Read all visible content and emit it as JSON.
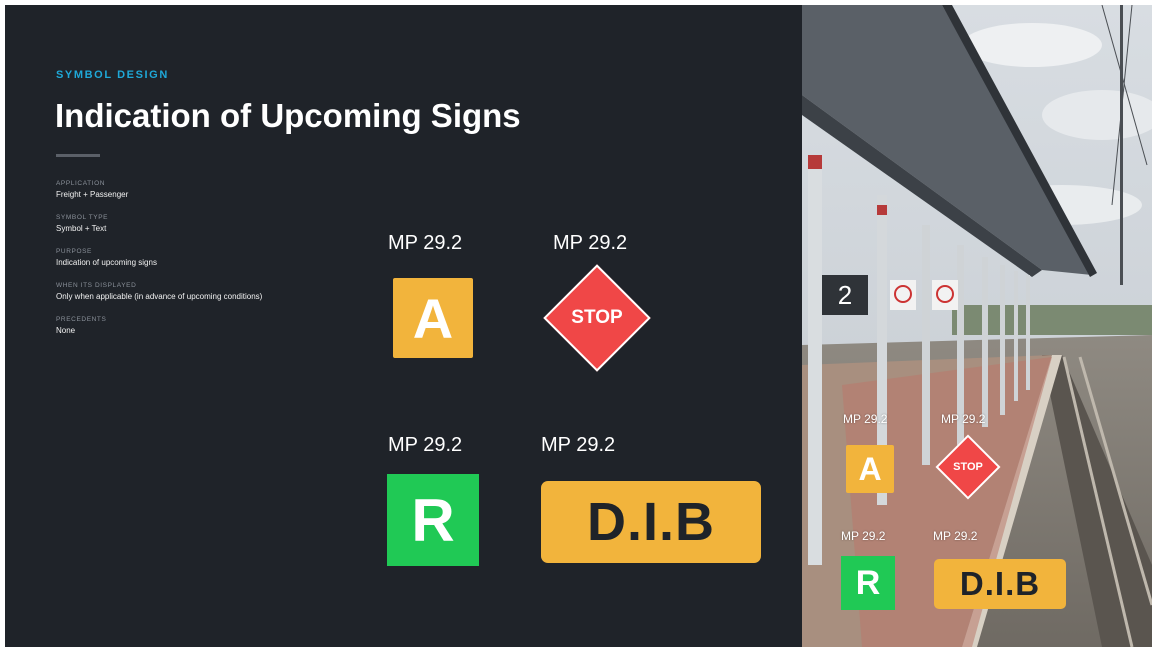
{
  "slide": {
    "eyebrow": "SYMBOL DESIGN",
    "title": "Indication of Upcoming Signs",
    "meta": [
      {
        "label": "APPLICATION",
        "value": "Freight + Passenger"
      },
      {
        "label": "SYMBOL TYPE",
        "value": "Symbol + Text"
      },
      {
        "label": "PURPOSE",
        "value": "Indication of upcoming signs"
      },
      {
        "label": "WHEN ITS DISPLAYED",
        "value": "Only when applicable (in advance of upcoming conditions)"
      },
      {
        "label": "PRECEDENTS",
        "value": "None"
      }
    ],
    "signs": {
      "a": {
        "mp": "MP 29.2",
        "label": "A"
      },
      "stop": {
        "mp": "MP 29.2",
        "label": "STOP"
      },
      "r": {
        "mp": "MP 29.2",
        "label": "R"
      },
      "dib": {
        "mp": "MP 29.2",
        "label": "D.I.B"
      }
    }
  },
  "photo": {
    "platform_number": "2",
    "overlay": {
      "a": {
        "mp": "MP 29.2",
        "label": "A"
      },
      "stop": {
        "mp": "MP 29.2",
        "label": "STOP"
      },
      "r": {
        "mp": "MP 29.2",
        "label": "R"
      },
      "dib": {
        "mp": "MP 29.2",
        "label": "D.I.B"
      }
    }
  },
  "colors": {
    "background": "#1f2329",
    "accent": "#1fa8d8",
    "sign_yellow": "#f2b43c",
    "sign_red": "#f04747",
    "sign_green": "#20c955"
  }
}
